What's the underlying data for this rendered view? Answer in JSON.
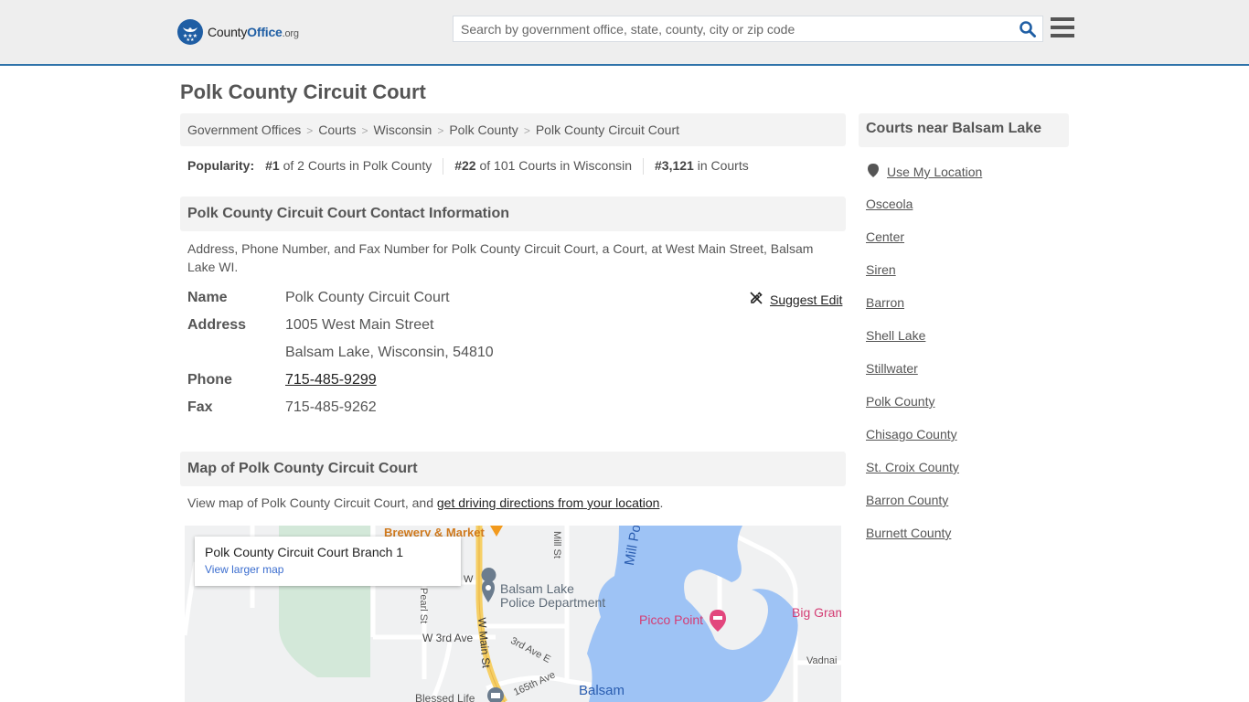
{
  "header": {
    "logo": {
      "part1": "County",
      "part2": "Office",
      "part3": ".org"
    },
    "search_placeholder": "Search by government office, state, county, city or zip code",
    "colors": {
      "brand": "#1f5ea4",
      "header_bg": "#eeeeee",
      "header_border": "#2f73aa"
    }
  },
  "page_title": "Polk County Circuit Court",
  "breadcrumb": [
    "Government Offices",
    "Courts",
    "Wisconsin",
    "Polk County",
    "Polk County Circuit Court"
  ],
  "popularity": {
    "label": "Popularity:",
    "items": [
      {
        "rank": "#1",
        "text": " of 2 Courts in Polk County"
      },
      {
        "rank": "#22",
        "text": " of 101 Courts in Wisconsin"
      },
      {
        "rank": "#3,121",
        "text": " in Courts"
      }
    ]
  },
  "contact": {
    "heading": "Polk County Circuit Court Contact Information",
    "description": "Address, Phone Number, and Fax Number for Polk County Circuit Court, a Court, at West Main Street, Balsam Lake WI.",
    "suggest_edit": "Suggest Edit",
    "rows": {
      "name_label": "Name",
      "name_value": "Polk County Circuit Court",
      "address_label": "Address",
      "address_line1": "1005 West Main Street",
      "address_line2": "Balsam Lake, Wisconsin, 54810",
      "phone_label": "Phone",
      "phone_value": "715-485-9299",
      "fax_label": "Fax",
      "fax_value": "715-485-9262"
    }
  },
  "map_section": {
    "heading": "Map of Polk County Circuit Court",
    "desc_prefix": "View map of Polk County Circuit Court, and ",
    "directions_link": "get driving directions from your location",
    "desc_suffix": ".",
    "map": {
      "card_title": "Polk County Circuit Court Branch 1",
      "card_link": "View larger map",
      "labels": {
        "brewery": "Brewery & Market",
        "police": "Balsam Lake\nPolice Department",
        "police_l1": "Balsam Lake",
        "police_l2": "Police Department",
        "mill_pond": "Mill Pond",
        "picco_point": "Picco Point",
        "big_gram": "Big Gram",
        "mill_st": "Mill St",
        "pearl_st": "Pearl St",
        "w_main_st": "W Main St",
        "w_3rd_ave": "W 3rd Ave",
        "3rd_ave_e": "3rd Ave E",
        "165th_ave": "165th Ave",
        "balsam": "Balsam",
        "blessed_life": "Blessed Life",
        "vadnai": "Vadnai",
        "w": "W"
      }
    }
  },
  "sidebar": {
    "heading": "Courts near Balsam Lake",
    "use_location": "Use My Location",
    "links": [
      "Osceola",
      "Center",
      "Siren",
      "Barron",
      "Shell Lake",
      "Stillwater",
      "Polk County",
      "Chisago County",
      "St. Croix County",
      "Barron County",
      "Burnett County"
    ]
  }
}
